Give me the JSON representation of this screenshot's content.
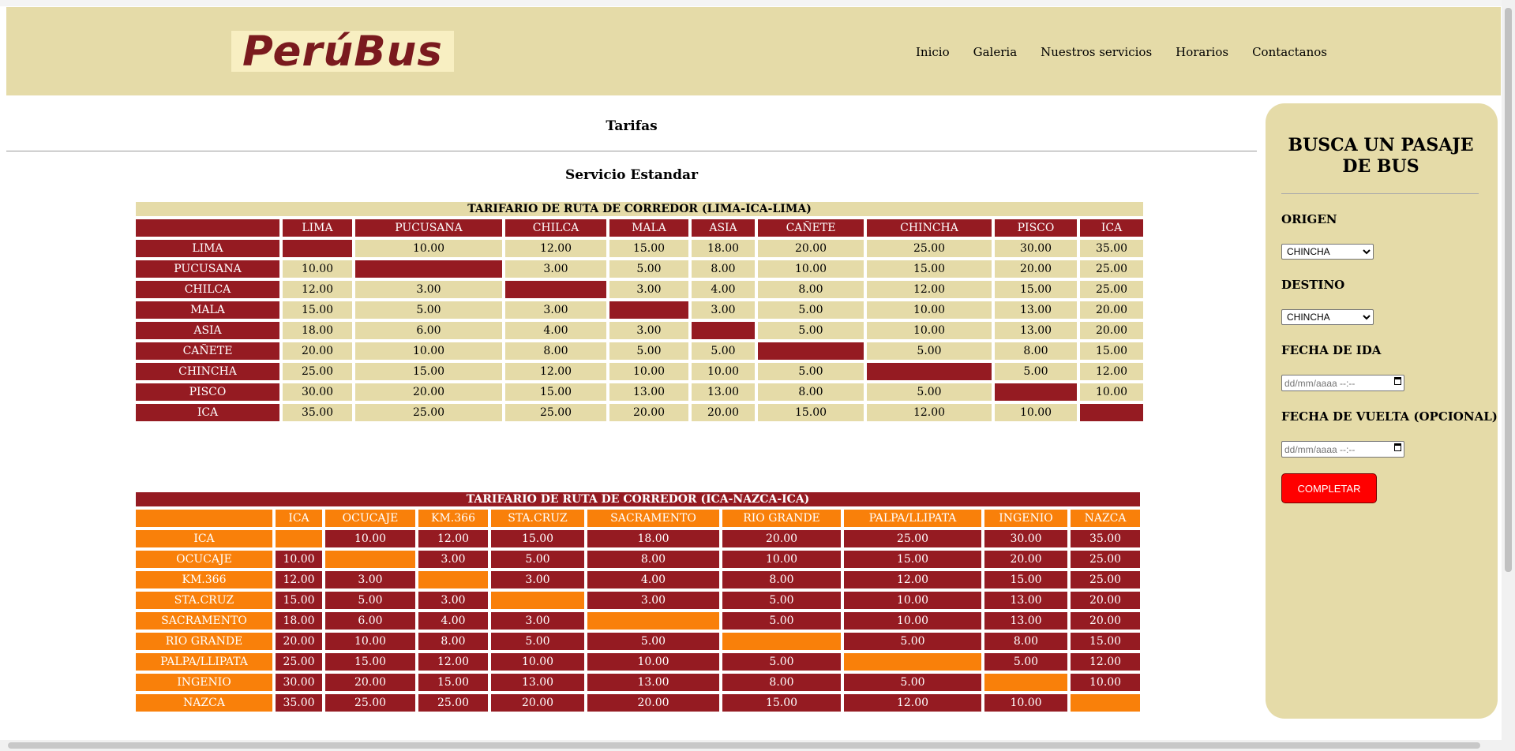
{
  "header": {
    "logo_text": "PerúBus",
    "nav": [
      "Inicio",
      "Galeria",
      "Nuestros servicios",
      "Horarios",
      "Contactanos"
    ]
  },
  "main": {
    "title": "Tarifas",
    "subtitle": "Servicio Estandar"
  },
  "table1": {
    "caption": "TARIFARIO DE RUTA DE CORREDOR (LIMA-ICA-LIMA)",
    "headers": [
      "",
      "LIMA",
      "PUCUSANA",
      "CHILCA",
      "MALA",
      "ASIA",
      "CAÑETE",
      "CHINCHA",
      "PISCO",
      "ICA"
    ],
    "rows": [
      [
        "LIMA",
        "",
        "10.00",
        "12.00",
        "15.00",
        "18.00",
        "20.00",
        "25.00",
        "30.00",
        "35.00"
      ],
      [
        "PUCUSANA",
        "10.00",
        "",
        "3.00",
        "5.00",
        "8.00",
        "10.00",
        "15.00",
        "20.00",
        "25.00"
      ],
      [
        "CHILCA",
        "12.00",
        "3.00",
        "",
        "3.00",
        "4.00",
        "8.00",
        "12.00",
        "15.00",
        "25.00"
      ],
      [
        "MALA",
        "15.00",
        "5.00",
        "3.00",
        "",
        "3.00",
        "5.00",
        "10.00",
        "13.00",
        "20.00"
      ],
      [
        "ASIA",
        "18.00",
        "6.00",
        "4.00",
        "3.00",
        "",
        "5.00",
        "10.00",
        "13.00",
        "20.00"
      ],
      [
        "CAÑETE",
        "20.00",
        "10.00",
        "8.00",
        "5.00",
        "5.00",
        "",
        "5.00",
        "8.00",
        "15.00"
      ],
      [
        "CHINCHA",
        "25.00",
        "15.00",
        "12.00",
        "10.00",
        "10.00",
        "5.00",
        "",
        "5.00",
        "12.00"
      ],
      [
        "PISCO",
        "30.00",
        "20.00",
        "15.00",
        "13.00",
        "13.00",
        "8.00",
        "5.00",
        "",
        "10.00"
      ],
      [
        "ICA",
        "35.00",
        "25.00",
        "25.00",
        "20.00",
        "20.00",
        "15.00",
        "12.00",
        "10.00",
        ""
      ]
    ]
  },
  "table2": {
    "caption": "TARIFARIO DE RUTA DE CORREDOR (ICA-NAZCA-ICA)",
    "headers": [
      "",
      "ICA",
      "OCUCAJE",
      "KM.366",
      "STA.CRUZ",
      "SACRAMENTO",
      "RIO GRANDE",
      "PALPA/LLIPATA",
      "INGENIO",
      "NAZCA"
    ],
    "rows": [
      [
        "ICA",
        "",
        "10.00",
        "12.00",
        "15.00",
        "18.00",
        "20.00",
        "25.00",
        "30.00",
        "35.00"
      ],
      [
        "OCUCAJE",
        "10.00",
        "",
        "3.00",
        "5.00",
        "8.00",
        "10.00",
        "15.00",
        "20.00",
        "25.00"
      ],
      [
        "KM.366",
        "12.00",
        "3.00",
        "",
        "3.00",
        "4.00",
        "8.00",
        "12.00",
        "15.00",
        "25.00"
      ],
      [
        "STA.CRUZ",
        "15.00",
        "5.00",
        "3.00",
        "",
        "3.00",
        "5.00",
        "10.00",
        "13.00",
        "20.00"
      ],
      [
        "SACRAMENTO",
        "18.00",
        "6.00",
        "4.00",
        "3.00",
        "",
        "5.00",
        "10.00",
        "13.00",
        "20.00"
      ],
      [
        "RIO GRANDE",
        "20.00",
        "10.00",
        "8.00",
        "5.00",
        "5.00",
        "",
        "5.00",
        "8.00",
        "15.00"
      ],
      [
        "PALPA/LLIPATA",
        "25.00",
        "15.00",
        "12.00",
        "10.00",
        "10.00",
        "5.00",
        "",
        "5.00",
        "12.00"
      ],
      [
        "INGENIO",
        "30.00",
        "20.00",
        "15.00",
        "13.00",
        "13.00",
        "8.00",
        "5.00",
        "",
        "10.00"
      ],
      [
        "NAZCA",
        "35.00",
        "25.00",
        "25.00",
        "20.00",
        "20.00",
        "15.00",
        "12.00",
        "10.00",
        ""
      ]
    ]
  },
  "sidebar": {
    "title": "BUSCA UN PASAJE DE BUS",
    "origen_label": "ORIGEN",
    "origen_value": "CHINCHA",
    "destino_label": "DESTINO",
    "destino_value": "CHINCHA",
    "fecha_ida_label": "FECHA DE IDA",
    "fecha_ida_placeholder": "dd/mm/aaaa --:--",
    "fecha_vuelta_label": "FECHA DE VUELTA (OPCIONAL)",
    "fecha_vuelta_placeholder": "dd/mm/aaaa --:--",
    "submit_label": "COMPLETAR"
  },
  "colors": {
    "beige": "#e5dba8",
    "maroon": "#951b22",
    "orange": "#f9800a",
    "button_red": "#ff0000"
  }
}
